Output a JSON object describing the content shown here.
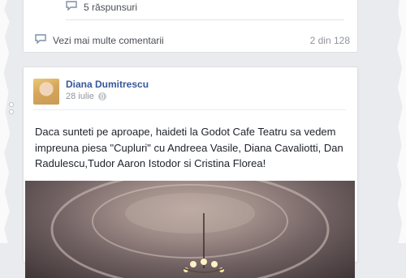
{
  "thread": {
    "replies_label": "5 răspunsuri",
    "more_comments_label": "Vezi mai multe comentarii",
    "pager": "2 din 128"
  },
  "post": {
    "author_name": "Diana Dumitrescu",
    "date": "28 iulie",
    "text": "Daca sunteti pe aproape, haideti la Godot Cafe Teatru sa vedem impreuna piesa \"Cupluri\" cu Andreea Vasile, Diana Cavaliotti, Dan Radulescu,Tudor Aaron Istodor si Cristina Florea!"
  },
  "icons": {
    "replies": "speech-bubble-icon",
    "more_comments": "speech-bubble-icon",
    "privacy": "globe-icon"
  },
  "colors": {
    "link": "#365899",
    "page_bg": "#e9ebee",
    "text": "#1d2129",
    "muted": "#90949c"
  }
}
